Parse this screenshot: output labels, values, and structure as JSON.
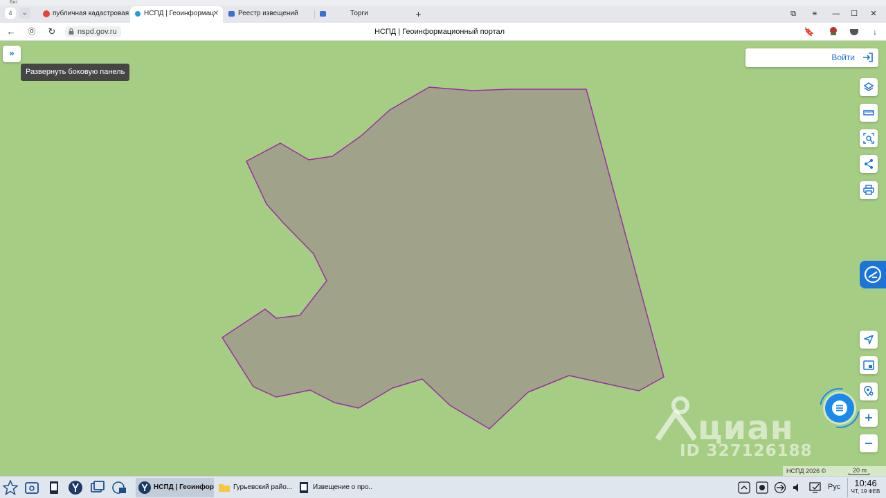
{
  "browser": {
    "top_strip_text": "Бит",
    "tab_count": "4",
    "tabs": [
      {
        "label": "публичная кадастровая",
        "icon": "yandex-icon",
        "active": false
      },
      {
        "label": "НСПД | Геоинформац",
        "icon": "nspd-icon",
        "active": true
      },
      {
        "label": "Реестр извещений",
        "icon": "gerb-icon",
        "active": false
      },
      {
        "label": "Торги",
        "icon": "gerb-icon",
        "active": false
      }
    ],
    "url": "nspd.gov.ru",
    "page_title": "НСПД | Геоинформационный портал"
  },
  "map": {
    "expand_sidebar_tooltip": "Развернуть боковую панель",
    "login_label": "Войти",
    "copyright": "НСПД 2026 ©",
    "scale_label": "20 m",
    "watermark_text": "циан",
    "watermark_id": "ID 327126188",
    "parcel_stroke_color": "#9b2ea0",
    "parcel_fill_color": "#a0a38a"
  },
  "tools": [
    "layers-icon",
    "ruler-icon",
    "select-area-icon",
    "share-icon",
    "print-icon",
    "locate-icon",
    "minimap-icon",
    "geo-search-icon",
    "zoom-in-icon",
    "zoom-out-icon"
  ],
  "taskbar": {
    "tasks": [
      {
        "label": "НСПД | Геоинфор...",
        "active": true
      },
      {
        "label": "Гурьевский райо...",
        "active": false
      },
      {
        "label": "Извещение о про...",
        "active": false
      }
    ],
    "language": "Рус",
    "time": "10:46",
    "date": "ЧТ, 19 ФЕВ"
  }
}
